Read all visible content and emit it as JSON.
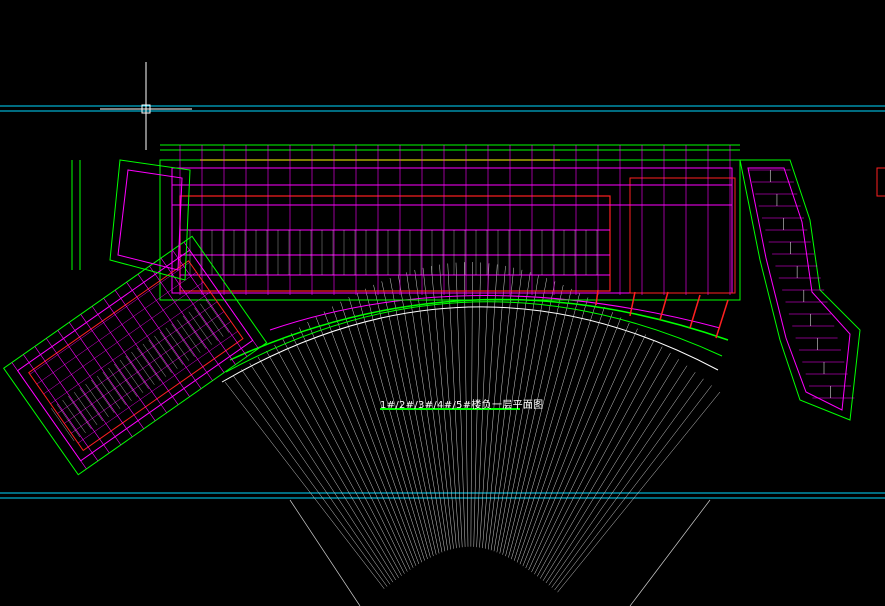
{
  "drawing": {
    "title": "1#/2#/3#/4#/5#楼负一层平面图"
  },
  "colors": {
    "background": "#000000",
    "frame": "#00d8ff",
    "grid": "#00ff00",
    "wall": "#ff00ff",
    "boundary": "#ff2020",
    "detail": "#ffffff",
    "accent": "#ffff00",
    "dim": "#cfcfcf"
  },
  "icons": {
    "crosshair": "crosshair-icon"
  }
}
